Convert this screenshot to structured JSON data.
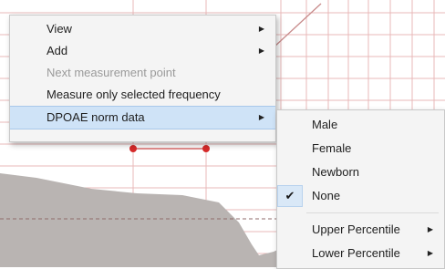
{
  "context_menu": {
    "items": [
      {
        "label": "View",
        "has_submenu": true,
        "disabled": false
      },
      {
        "label": "Add",
        "has_submenu": true,
        "disabled": false
      },
      {
        "label": "Next measurement point",
        "has_submenu": false,
        "disabled": true
      },
      {
        "label": "Measure only selected  frequency",
        "has_submenu": false,
        "disabled": false
      },
      {
        "label": "DPOAE norm data",
        "has_submenu": true,
        "disabled": false,
        "highlighted": true
      }
    ],
    "submenu_arrow": "▶"
  },
  "norm_data_submenu": {
    "items": [
      {
        "label": "Male",
        "checked": false
      },
      {
        "label": "Female",
        "checked": false
      },
      {
        "label": "Newborn",
        "checked": false
      },
      {
        "label": "None",
        "checked": true
      },
      {
        "label": "Upper Percentile",
        "has_submenu": true
      },
      {
        "label": "Lower Percentile",
        "has_submenu": true
      }
    ],
    "check_glyph": "✔",
    "submenu_arrow": "▶"
  },
  "colors": {
    "menu_bg": "#f4f4f4",
    "highlight": "#cfe3f7",
    "grid_line": "#e9b9b9",
    "data_point": "#d62a2a",
    "norm_area": "#b9b4b2"
  }
}
